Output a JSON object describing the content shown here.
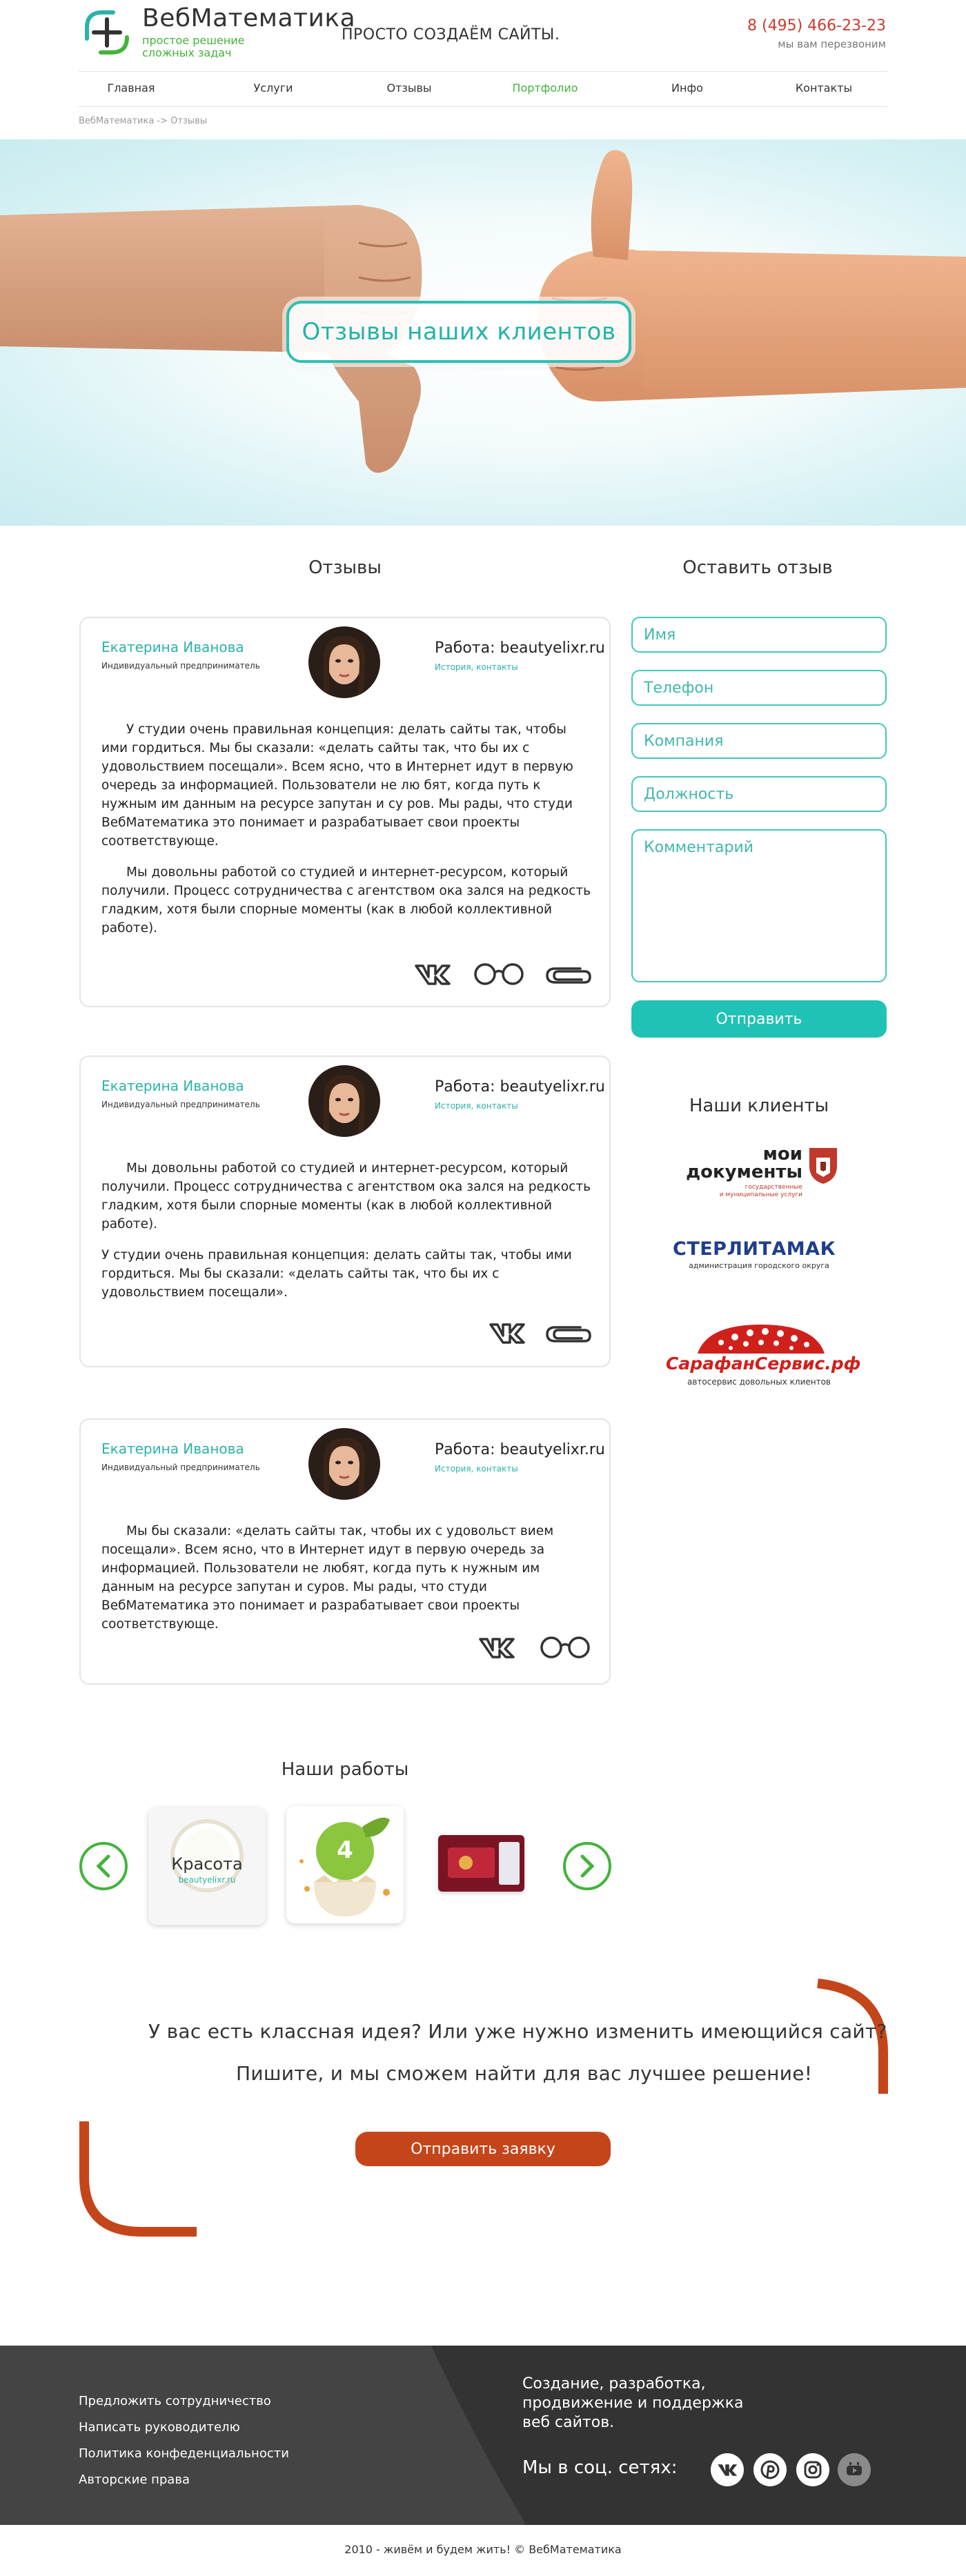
{
  "header": {
    "logo_title": "ВебМатематика",
    "logo_sub_line1": "простое решение",
    "logo_sub_line2": "сложных задач",
    "slogan": "ПРОСТО СОЗДАЁМ САЙТЫ.",
    "phone": "8 (495) 466-23-23",
    "callback": "мы вам перезвоним"
  },
  "nav": [
    "Главная",
    "Услуги",
    "Отзывы",
    "Портфолио",
    "Инфо",
    "Контакты"
  ],
  "nav_active": "Портфолио",
  "breadcrumb": "ВебМатематика -> Отзывы",
  "hero": {
    "title": "Отзывы наших клиентов"
  },
  "reviews_heading": "Отзывы",
  "reviews": [
    {
      "name": "Екатерина Иванова",
      "role": "Индивидуальный предприниматель",
      "work": "Работа: beautyelixr.ru",
      "links": "История, контакты",
      "paragraphs": [
        "У студии очень правильная концепция: делать сайты так, чтобы ими гордиться. Мы бы сказали: «делать сайты так, что бы их с удовольствием посещали». Всем ясно, что в Интернет идут в первую очередь за информацией. Пользователи не лю бят, когда путь к нужным им данным на ресурсе запутан и су ров. Мы рады, что студи ВебМатематика это понимает и разрабатывает свои проекты соответствующе.",
        "Мы довольны работой со студией и интернет-ресурсом, который получили. Процесс сотрудничества с агентством ока зался на редкость гладким, хотя были спорные моменты (как в любой коллективной работе)."
      ],
      "icons": [
        "vk-icon",
        "glasses-icon",
        "paperclip-icon"
      ]
    },
    {
      "name": "Екатерина Иванова",
      "role": "Индивидуальный предприниматель",
      "work": "Работа: beautyelixr.ru",
      "links": "История, контакты",
      "paragraphs": [
        "Мы довольны работой со студией и интернет-ресурсом, который получили. Процесс сотрудничества с агентством ока зался на редкость гладким, хотя были спорные моменты (как в любой коллективной работе).",
        "У студии очень правильная концепция: делать сайты так, чтобы ими гордиться. Мы бы сказали: «делать сайты так, что бы их с удовольствием посещали»."
      ],
      "icons": [
        "vk-icon",
        "paperclip-icon"
      ]
    },
    {
      "name": "Екатерина Иванова",
      "role": "Индивидуальный предприниматель",
      "work": "Работа: beautyelixr.ru",
      "links": "История, контакты",
      "paragraphs": [
        "Мы бы сказали: «делать сайты так, чтобы их с удовольст вием посещали». Всем ясно, что в Интернет идут в первую очередь за информацией. Пользователи не любят, когда путь к нужным им данным на ресурсе запутан и суров. Мы рады, что студи ВебМатематика это понимает и разрабатывает свои проекты соответствующе."
      ],
      "icons": [
        "vk-icon",
        "glasses-icon"
      ]
    }
  ],
  "form": {
    "heading": "Оставить отзыв",
    "name_placeholder": "Имя",
    "phone_placeholder": "Телефон",
    "company_placeholder": "Компания",
    "position_placeholder": "Должность",
    "comment_placeholder": "Комментарий",
    "submit_label": "Отправить"
  },
  "clients": {
    "heading": "Наши клиенты",
    "items": [
      {
        "line1": "мои",
        "line2": "документы",
        "sub1": "государственные",
        "sub2": "и муниципальные услуги"
      },
      {
        "line1": "СТЕРЛИТАМАК",
        "sub1": "администрация городского округа"
      },
      {
        "line1": "СарафанСервис.рф",
        "sub1": "автосервис довольных клиентов"
      }
    ]
  },
  "works": {
    "heading": "Наши работы",
    "items": [
      {
        "title": "Красота",
        "sub": "beautyelixr.ru"
      },
      {
        "badge": "4"
      },
      {
        "label": "card"
      }
    ]
  },
  "cta": {
    "line1": "У вас есть классная идея? Или уже нужно изменить имеющийся сайт?",
    "line2": "Пишите, и мы сможем найти для вас лучшее решение!",
    "button": "Отправить заявку"
  },
  "footer": {
    "links": [
      "Предложить сотрудничество",
      "Написать руководителю",
      "Политика конфеденциальности",
      "Авторские права"
    ],
    "tagline_1": "Создание, разработка,",
    "tagline_2": "продвижение и поддержка",
    "tagline_3": "веб сайтов.",
    "social_label": "Мы в соц. сетях:",
    "copyright": "2010 - живём и будем жить!  ©  ВебМатематика"
  },
  "colors": {
    "accent": "#2bb3a7",
    "green": "#43b33c",
    "red": "#d03a2a",
    "orange": "#c5451b",
    "footer_bg": "#333333"
  }
}
